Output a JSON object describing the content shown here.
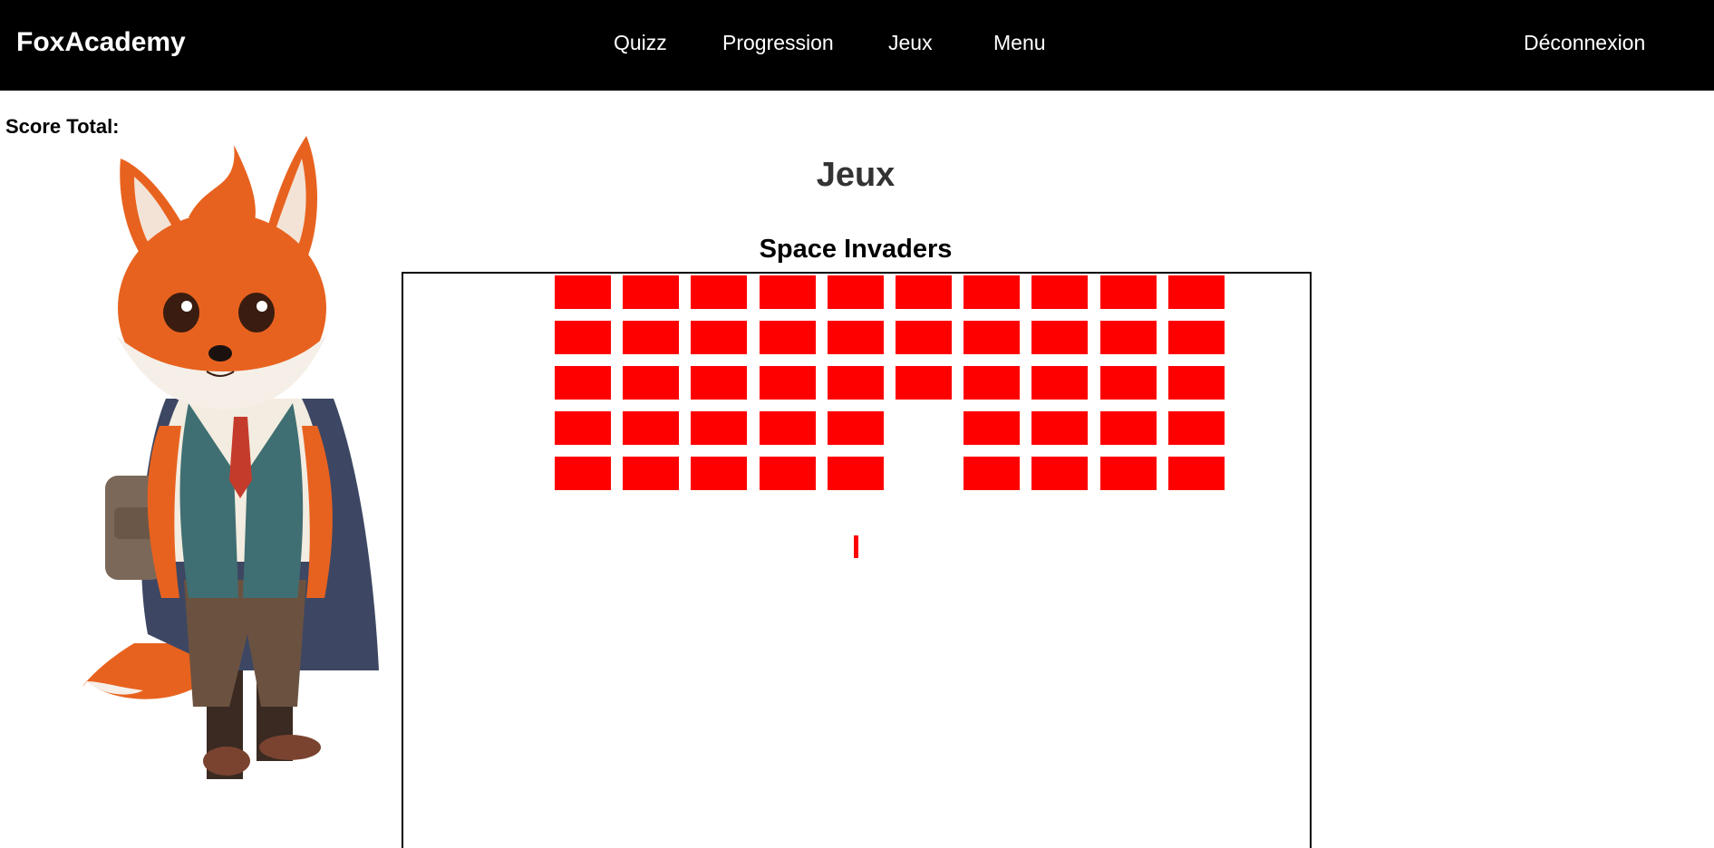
{
  "app": {
    "brand": "FoxAcademy"
  },
  "nav": {
    "items": [
      {
        "label": "Quizz"
      },
      {
        "label": "Progression"
      },
      {
        "label": "Jeux"
      },
      {
        "label": "Menu"
      }
    ],
    "logout_label": "Déconnexion"
  },
  "score": {
    "label": "Score Total:",
    "value": ""
  },
  "page": {
    "title": "Jeux"
  },
  "game": {
    "title": "Space Invaders",
    "invader_color": "#ff0000",
    "bullet_color": "#ff0000",
    "rows": 5,
    "cols": 10,
    "destroyed": [
      [
        3,
        5
      ],
      [
        4,
        5
      ]
    ]
  },
  "colors": {
    "navbar_bg": "#000000",
    "nav_text": "#ffffff",
    "page_bg": "#ffffff",
    "title_text": "#333333",
    "fox_orange": "#e8621f"
  },
  "icons": {
    "mascot": "fox-student-mascot"
  }
}
